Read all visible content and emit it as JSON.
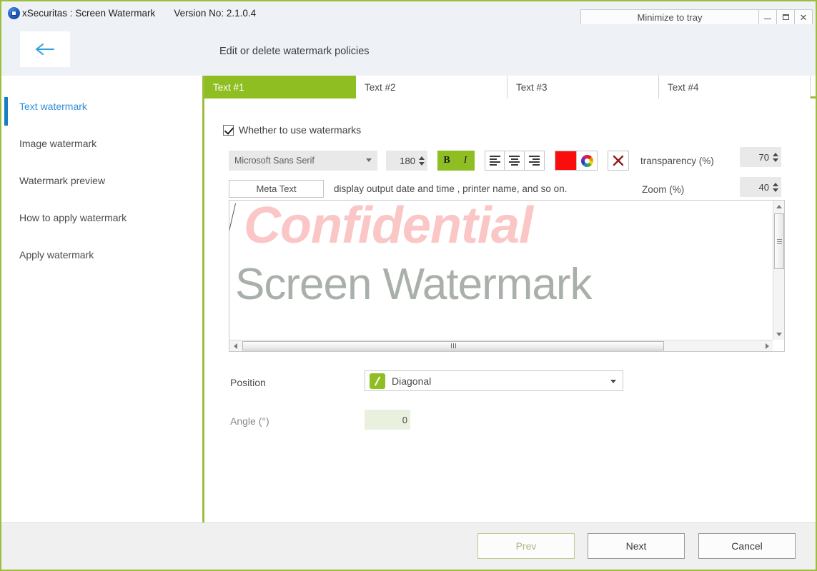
{
  "window": {
    "app_icon": "app-logo-icon",
    "title": "xSecuritas : Screen Watermark",
    "version": "Version No: 2.1.0.4",
    "minimize_to_tray": "Minimize to tray",
    "minimize_icon": "minimize-icon",
    "maximize_icon": "maximize-icon",
    "close_icon": "close-icon",
    "accent_green": "#8fbe22",
    "accent_blue": "#1a7fc1"
  },
  "header": {
    "back_icon": "arrow-left-icon",
    "title": "Edit or delete watermark policies"
  },
  "sidebar": {
    "items": [
      {
        "label": "Text watermark",
        "active": true
      },
      {
        "label": "Image watermark",
        "active": false
      },
      {
        "label": "Watermark preview",
        "active": false
      },
      {
        "label": "How to apply watermark",
        "active": false
      },
      {
        "label": "Apply watermark",
        "active": false
      }
    ]
  },
  "tabs": [
    {
      "label": "Text #1",
      "active": true
    },
    {
      "label": "Text #2",
      "active": false
    },
    {
      "label": "Text #3",
      "active": false
    },
    {
      "label": "Text #4",
      "active": false
    }
  ],
  "form": {
    "use_watermarks_label": "Whether to use watermarks",
    "use_watermarks_checked": true,
    "font_family_value": "Microsoft Sans Serif",
    "font_size_value": "180",
    "bold_label": "B",
    "italic_label": "I",
    "align_left_icon": "align-left-icon",
    "align_center_icon": "align-center-icon",
    "align_right_icon": "align-right-icon",
    "text_color": "#fa0d0d",
    "color_wheel_icon": "color-wheel-icon",
    "clear_color_icon": "clear-color-x-icon",
    "transparency_label": "transparency (%)",
    "transparency_value": "70",
    "meta_text_label": "Meta Text",
    "meta_text_hint": "display output date and time , printer name, and so on.",
    "zoom_label": "Zoom (%)",
    "zoom_value": "40"
  },
  "preview": {
    "line1": "Confidential",
    "line2": "Screen Watermark",
    "line1_color": "#fac6c6",
    "line2_color": "#a9b0a9",
    "scroll_up_icon": "scroll-up-arrow-icon",
    "scroll_down_icon": "scroll-down-arrow-icon",
    "scroll_left_icon": "scroll-left-arrow-icon",
    "scroll_right_icon": "scroll-right-arrow-icon"
  },
  "position": {
    "label": "Position",
    "icon": "diagonal-icon",
    "value": "Diagonal",
    "angle_label": "Angle (°)",
    "angle_value": "0"
  },
  "footer": {
    "prev": "Prev",
    "next": "Next",
    "cancel": "Cancel"
  }
}
